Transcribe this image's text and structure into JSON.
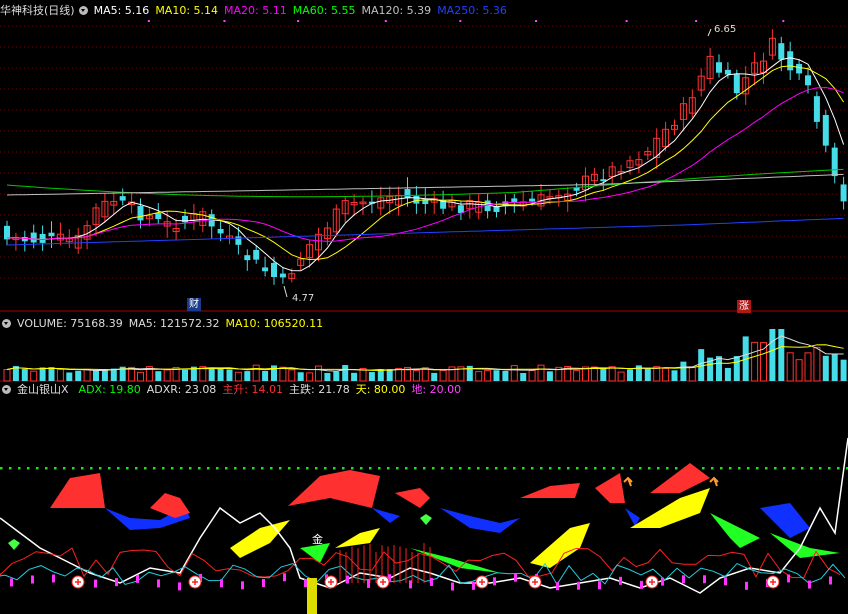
{
  "main_panel": {
    "title": "华神科技(日线)",
    "indicators": [
      {
        "label": "MA5: 5.16",
        "color": "#ffffff"
      },
      {
        "label": "MA10: 5.14",
        "color": "#ffff00"
      },
      {
        "label": "MA20: 5.11",
        "color": "#ff00ff"
      },
      {
        "label": "MA60: 5.55",
        "color": "#00ff00"
      },
      {
        "label": "MA120: 5.39",
        "color": "#c0c0c0"
      },
      {
        "label": "MA250: 5.36",
        "color": "#2040ff"
      }
    ],
    "high_label": "6.65",
    "low_label": "4.77",
    "tag_left": "财",
    "tag_right": "涨"
  },
  "volume_panel": {
    "indicators": [
      {
        "label": "VOLUME: 75168.39",
        "color": "#dddddd"
      },
      {
        "label": "MA5: 121572.32",
        "color": "#dddddd"
      },
      {
        "label": "MA10: 106520.11",
        "color": "#ffff00"
      }
    ]
  },
  "indicator_panel": {
    "title": "金山银山X",
    "indicators": [
      {
        "label": "ADX: 19.80",
        "color": "#00ff00"
      },
      {
        "label": "ADXR: 23.08",
        "color": "#dddddd"
      },
      {
        "label": "主升: 14.01",
        "color": "#ff3030"
      },
      {
        "label": "主跌: 21.78",
        "color": "#dddddd"
      },
      {
        "label": "天: 80.00",
        "color": "#ffff00"
      },
      {
        "label": "地: 20.00",
        "color": "#ff44ff"
      }
    ],
    "marker_char": "金"
  },
  "colors": {
    "up": "#ff3232",
    "down": "#44dde8",
    "grid": "#7a0000"
  }
}
